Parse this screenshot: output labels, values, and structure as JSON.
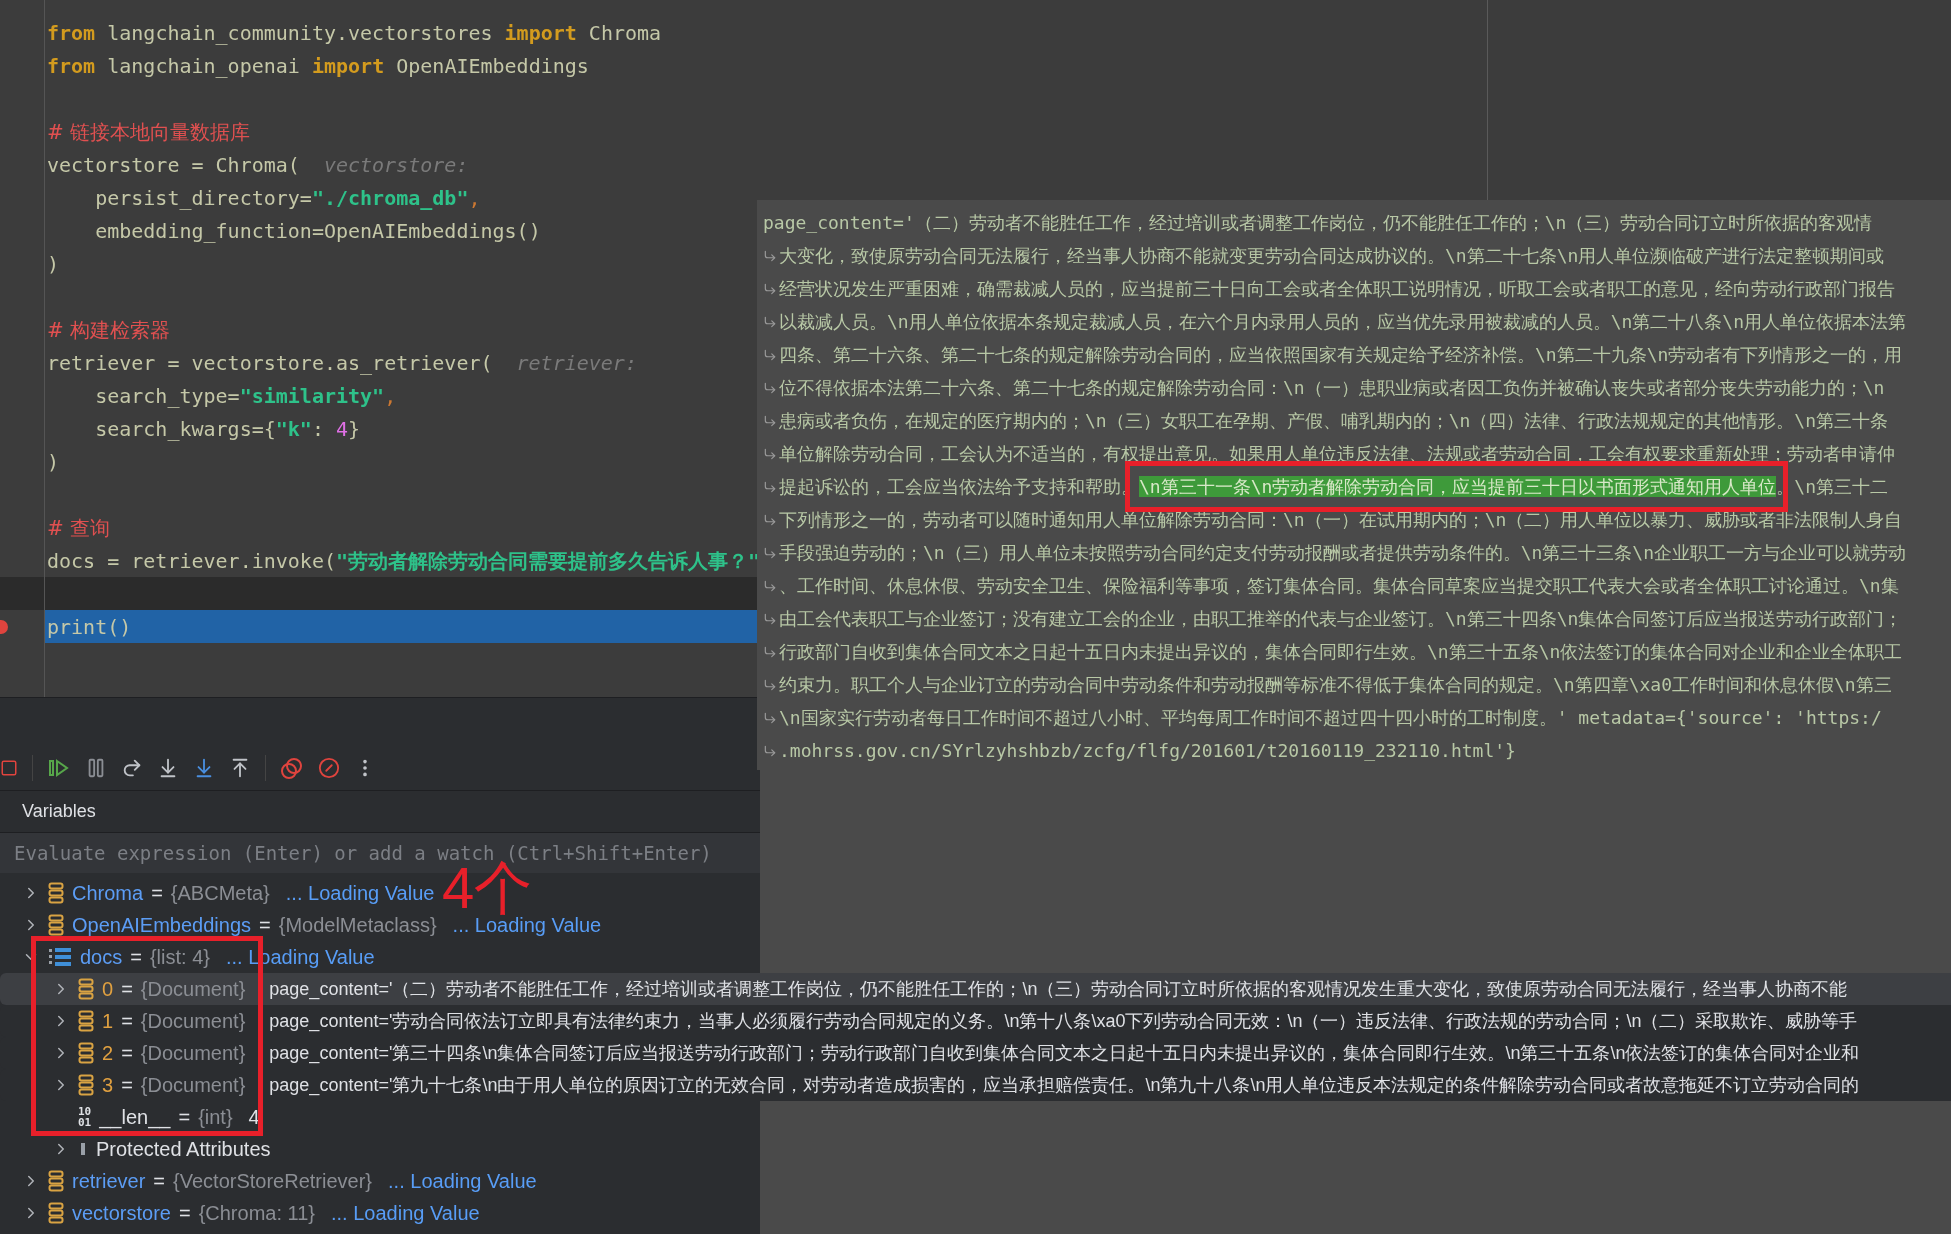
{
  "editor": {
    "lines": [
      {
        "segments": [
          {
            "kind": "kw",
            "text": "from"
          },
          {
            "kind": "plain",
            "text": " langchain_community.vectorstores "
          },
          {
            "kind": "kw",
            "text": "import"
          },
          {
            "kind": "plain",
            "text": " Chroma"
          }
        ],
        "caret_line": false,
        "execution_point": false,
        "breakpoint": false
      },
      {
        "segments": [
          {
            "kind": "kw",
            "text": "from"
          },
          {
            "kind": "plain",
            "text": " langchain_openai "
          },
          {
            "kind": "kw",
            "text": "import"
          },
          {
            "kind": "plain",
            "text": " OpenAIEmbeddings"
          }
        ],
        "caret_line": false,
        "execution_point": false,
        "breakpoint": false
      },
      {
        "caret_line": false,
        "execution_point": false,
        "breakpoint": false
      },
      {
        "segments": [
          {
            "kind": "comment",
            "text": "# 链接本地向量数据库"
          }
        ],
        "caret_line": false,
        "execution_point": false,
        "breakpoint": false
      },
      {
        "segments": [
          {
            "kind": "plain",
            "text": "vectorstore = Chroma("
          },
          {
            "kind": "hint",
            "text": "vectorstore:"
          }
        ],
        "caret_line": false,
        "execution_point": false,
        "breakpoint": false
      },
      {
        "segments": [
          {
            "kind": "plain",
            "text": "    persist_directory="
          },
          {
            "kind": "str",
            "text": "\"./chroma_db\""
          },
          {
            "kind": "punct",
            "text": ","
          }
        ],
        "caret_line": false,
        "execution_point": false,
        "breakpoint": false
      },
      {
        "segments": [
          {
            "kind": "plain",
            "text": "    embedding_function=OpenAIEmbeddings()"
          }
        ],
        "caret_line": false,
        "execution_point": false,
        "breakpoint": false
      },
      {
        "segments": [
          {
            "kind": "plain",
            "text": ")"
          }
        ],
        "caret_line": false,
        "execution_point": false,
        "breakpoint": false
      },
      {
        "caret_line": false,
        "execution_point": false,
        "breakpoint": false
      },
      {
        "segments": [
          {
            "kind": "comment",
            "text": "# 构建检索器"
          }
        ],
        "caret_line": false,
        "execution_point": false,
        "breakpoint": false
      },
      {
        "segments": [
          {
            "kind": "plain",
            "text": "retriever = vectorstore.as_retriever("
          },
          {
            "kind": "hint",
            "text": "retriever:"
          }
        ],
        "caret_line": false,
        "execution_point": false,
        "breakpoint": false
      },
      {
        "segments": [
          {
            "kind": "plain",
            "text": "    search_type="
          },
          {
            "kind": "str",
            "text": "\"similarity\""
          },
          {
            "kind": "punct",
            "text": ","
          }
        ],
        "caret_line": false,
        "execution_point": false,
        "breakpoint": false
      },
      {
        "segments": [
          {
            "kind": "plain",
            "text": "    search_kwargs={"
          },
          {
            "kind": "str",
            "text": "\"k\""
          },
          {
            "kind": "plain",
            "text": ": "
          },
          {
            "kind": "num",
            "text": "4"
          },
          {
            "kind": "plain",
            "text": "}"
          }
        ],
        "caret_line": false,
        "execution_point": false,
        "breakpoint": false
      },
      {
        "segments": [
          {
            "kind": "plain",
            "text": ")"
          }
        ],
        "caret_line": false,
        "execution_point": false,
        "breakpoint": false
      },
      {
        "caret_line": false,
        "execution_point": false,
        "breakpoint": false
      },
      {
        "segments": [
          {
            "kind": "comment",
            "text": "# 查询"
          }
        ],
        "caret_line": false,
        "execution_point": false,
        "breakpoint": false
      },
      {
        "segments": [
          {
            "kind": "plain",
            "text": "docs = retriever.invoke("
          },
          {
            "kind": "str",
            "text": "\"劳动者解除劳动合同需要提前多久告诉人事？\""
          }
        ],
        "caret_line": false,
        "execution_point": false,
        "breakpoint": false
      },
      {
        "caret_line": true,
        "execution_point": false,
        "breakpoint": false
      },
      {
        "segments": [
          {
            "kind": "plain",
            "text": "print()"
          }
        ],
        "caret_line": false,
        "execution_point": true,
        "breakpoint": true
      }
    ]
  },
  "tooltip": {
    "lines": [
      {
        "wrapped": false,
        "segments": [
          {
            "text": "page_content='（二）劳动者不能胜任工作，经过培训或者调整工作岗位，仍不能胜任工作的；\\n（三）劳动合同订立时所依据的客观情",
            "highlighted": false
          }
        ]
      },
      {
        "wrapped": true,
        "segments": [
          {
            "text": "大变化，致使原劳动合同无法履行，经当事人协商不能就变更劳动合同达成协议的。\\n第二十七条\\n用人单位濒临破产进行法定整顿期间或",
            "highlighted": false
          }
        ]
      },
      {
        "wrapped": true,
        "segments": [
          {
            "text": "经营状况发生严重困难，确需裁减人员的，应当提前三十日向工会或者全体职工说明情况，听取工会或者职工的意见，经向劳动行政部门报告",
            "highlighted": false
          }
        ]
      },
      {
        "wrapped": true,
        "segments": [
          {
            "text": "以裁减人员。\\n用人单位依据本条规定裁减人员，在六个月内录用人员的，应当优先录用被裁减的人员。\\n第二十八条\\n用人单位依据本法第",
            "highlighted": false
          }
        ]
      },
      {
        "wrapped": true,
        "segments": [
          {
            "text": "四条、第二十六条、第二十七条的规定解除劳动合同的，应当依照国家有关规定给予经济补偿。\\n第二十九条\\n劳动者有下列情形之一的，用",
            "highlighted": false
          }
        ]
      },
      {
        "wrapped": true,
        "segments": [
          {
            "text": "位不得依据本法第二十六条、第二十七条的规定解除劳动合同：\\n（一）患职业病或者因工负伤并被确认丧失或者部分丧失劳动能力的；\\n",
            "highlighted": false
          }
        ]
      },
      {
        "wrapped": true,
        "segments": [
          {
            "text": "患病或者负伤，在规定的医疗期内的；\\n（三）女职工在孕期、产假、哺乳期内的；\\n（四）法律、行政法规规定的其他情形。\\n第三十条",
            "highlighted": false
          }
        ]
      },
      {
        "wrapped": true,
        "segments": [
          {
            "text": "单位解除劳动合同，工会认为不适当的，有权提出意见。如果用人单位违反法律、法规或者劳动合同，工会有权要求重新处理；劳动者申请仲",
            "highlighted": false
          }
        ]
      },
      {
        "wrapped": true,
        "segments": [
          {
            "text": "提起诉讼的，工会应当依法给予支持和帮助。",
            "highlighted": false
          },
          {
            "text": "\\n第三十一条\\n劳动者解除劳动合同，应当提前三十日以书面形式通知用人单位",
            "highlighted": true
          },
          {
            "text": "。\\n第三十二",
            "highlighted": false
          }
        ]
      },
      {
        "wrapped": true,
        "segments": [
          {
            "text": "下列情形之一的，劳动者可以随时通知用人单位解除劳动合同：\\n（一）在试用期内的；\\n（二）用人单位以暴力、威胁或者非法限制人身自",
            "highlighted": false
          }
        ]
      },
      {
        "wrapped": true,
        "segments": [
          {
            "text": "手段强迫劳动的；\\n（三）用人单位未按照劳动合同约定支付劳动报酬或者提供劳动条件的。\\n第三十三条\\n企业职工一方与企业可以就劳动",
            "highlighted": false
          }
        ]
      },
      {
        "wrapped": true,
        "segments": [
          {
            "text": "、工作时间、休息休假、劳动安全卫生、保险福利等事项，签订集体合同。集体合同草案应当提交职工代表大会或者全体职工讨论通过。\\n集",
            "highlighted": false
          }
        ]
      },
      {
        "wrapped": true,
        "segments": [
          {
            "text": "由工会代表职工与企业签订；没有建立工会的企业，由职工推举的代表与企业签订。\\n第三十四条\\n集体合同签订后应当报送劳动行政部门；",
            "highlighted": false
          }
        ]
      },
      {
        "wrapped": true,
        "segments": [
          {
            "text": "行政部门自收到集体合同文本之日起十五日内未提出异议的，集体合同即行生效。\\n第三十五条\\n依法签订的集体合同对企业和企业全体职工",
            "highlighted": false
          }
        ]
      },
      {
        "wrapped": true,
        "segments": [
          {
            "text": "约束力。职工个人与企业订立的劳动合同中劳动条件和劳动报酬等标准不得低于集体合同的规定。\\n第四章\\xa0工作时间和休息休假\\n第三",
            "highlighted": false
          }
        ]
      },
      {
        "wrapped": true,
        "segments": [
          {
            "text": "\\n国家实行劳动者每日工作时间不超过八小时、平均每周工作时间不超过四十四小时的工时制度。' metadata={'source': 'https:/",
            "highlighted": false
          }
        ]
      },
      {
        "wrapped": true,
        "segments": [
          {
            "text": ".mohrss.gov.cn/SYrlzyhshbzb/zcfg/flfg/201601/t20160119_232110.html'}",
            "highlighted": false
          }
        ]
      }
    ]
  },
  "variables": {
    "title": "Variables",
    "watch_field": {
      "placeholder": "Evaluate expression (Enter) or add a watch (Ctrl+Shift+Enter)"
    },
    "items": [
      {
        "kind": "object",
        "name": "Chroma",
        "eq": "=",
        "type": "{ABCMeta}",
        "value": "... Loading Value",
        "expanded": false,
        "selected": false
      },
      {
        "kind": "object",
        "name": "OpenAIEmbeddings",
        "eq": "=",
        "type": "{ModelMetaclass}",
        "value": "... Loading Value",
        "expanded": false,
        "selected": false
      },
      {
        "kind": "list",
        "name": "docs",
        "eq": "=",
        "type": "{list: 4}",
        "value": "... Loading Value",
        "expanded": true,
        "selected": false,
        "children": [
          {
            "kind": "document",
            "name": "0",
            "eq": "=",
            "type": "{Document}",
            "value": "page_content='（二）劳动者不能胜任工作，经过培训或者调整工作岗位，仍不能胜任工作的；\\n（三）劳动合同订立时所依据的客观情况发生重大变化，致使原劳动合同无法履行，经当事人协商不能",
            "expanded": false,
            "selected": true
          },
          {
            "kind": "document",
            "name": "1",
            "eq": "=",
            "type": "{Document}",
            "value": "page_content='劳动合同依法订立即具有法律约束力，当事人必须履行劳动合同规定的义务。\\n第十八条\\xa0下列劳动合同无效：\\n（一）违反法律、行政法规的劳动合同；\\n（二）采取欺诈、威胁等手",
            "expanded": false,
            "selected": false
          },
          {
            "kind": "document",
            "name": "2",
            "eq": "=",
            "type": "{Document}",
            "value": "page_content='第三十四条\\n集体合同签订后应当报送劳动行政部门；劳动行政部门自收到集体合同文本之日起十五日内未提出异议的，集体合同即行生效。\\n第三十五条\\n依法签订的集体合同对企业和",
            "expanded": false,
            "selected": false
          },
          {
            "kind": "document",
            "name": "3",
            "eq": "=",
            "type": "{Document}",
            "value": "page_content='第九十七条\\n由于用人单位的原因订立的无效合同，对劳动者造成损害的，应当承担赔偿责任。\\n第九十八条\\n用人单位违反本法规定的条件解除劳动合同或者故意拖延不订立劳动合同的",
            "expanded": false,
            "selected": false
          },
          {
            "kind": "int",
            "name": "__len__",
            "eq": "=",
            "type": "{int}",
            "value": "4",
            "icon_text": [
              "10",
              "01"
            ],
            "selected": false
          },
          {
            "kind": "group",
            "name": "Protected Attributes",
            "expanded": false,
            "selected": false
          }
        ]
      },
      {
        "kind": "object",
        "name": "retriever",
        "eq": "=",
        "type": "{VectorStoreRetriever}",
        "value": "... Loading Value",
        "expanded": false,
        "selected": false
      },
      {
        "kind": "object",
        "name": "vectorstore",
        "eq": "=",
        "type": "{Chroma: 11}",
        "value": "... Loading Value",
        "expanded": false,
        "selected": false
      }
    ]
  },
  "annotation": {
    "text": "4个"
  }
}
